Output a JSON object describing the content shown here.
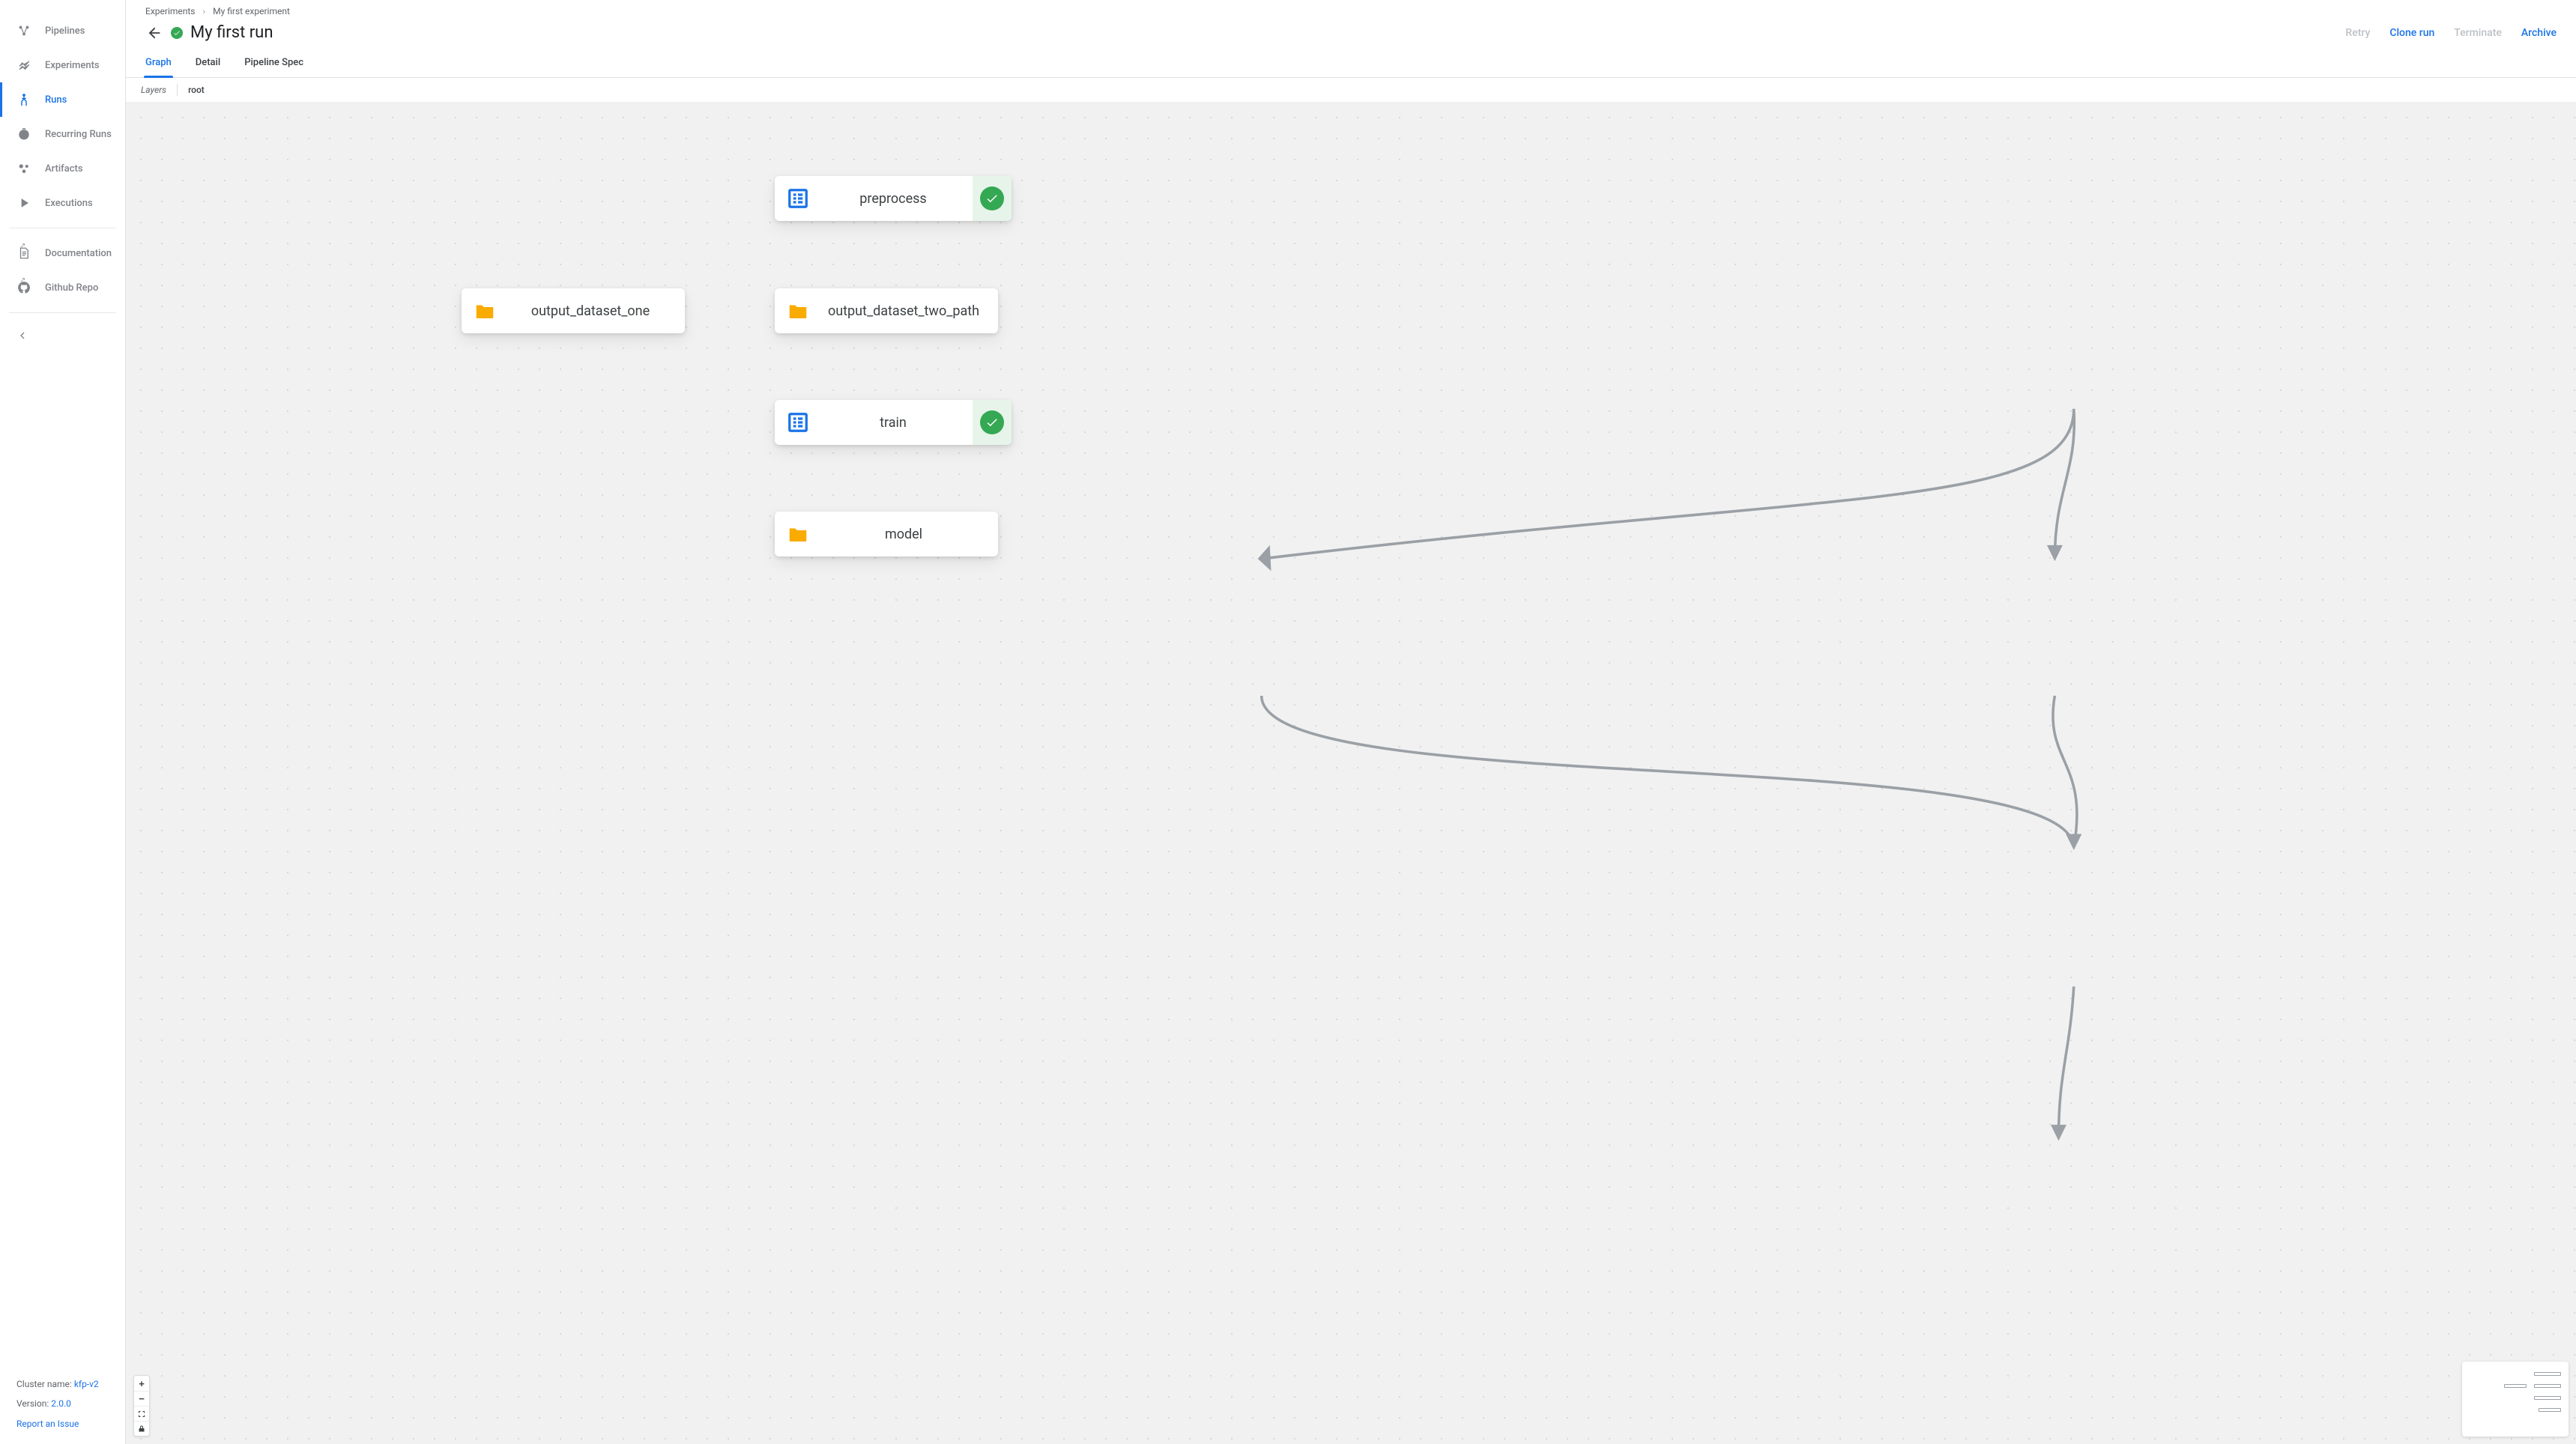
{
  "sidebar": {
    "items": [
      {
        "label": "Pipelines",
        "icon": "pipelines-icon",
        "active": false
      },
      {
        "label": "Experiments",
        "icon": "experiments-icon",
        "active": false
      },
      {
        "label": "Runs",
        "icon": "runs-icon",
        "active": true
      },
      {
        "label": "Recurring Runs",
        "icon": "recurring-runs-icon",
        "active": false
      },
      {
        "label": "Artifacts",
        "icon": "artifacts-icon",
        "active": false
      },
      {
        "label": "Executions",
        "icon": "executions-icon",
        "active": false
      }
    ],
    "external": [
      {
        "label": "Documentation",
        "icon": "documentation-icon"
      },
      {
        "label": "Github Repo",
        "icon": "github-icon"
      }
    ],
    "footer": {
      "cluster_label": "Cluster name:",
      "cluster_value": "kfp-v2",
      "version_label": "Version:",
      "version_value": "2.0.0",
      "report_label": "Report an Issue"
    }
  },
  "breadcrumbs": {
    "items": [
      "Experiments",
      "My first experiment"
    ]
  },
  "header": {
    "title": "My first run",
    "status": "success",
    "actions": {
      "retry": "Retry",
      "clone": "Clone run",
      "terminate": "Terminate",
      "archive": "Archive"
    }
  },
  "tabs": {
    "items": [
      "Graph",
      "Detail",
      "Pipeline Spec"
    ],
    "active": 0
  },
  "layers": {
    "label": "Layers",
    "root": "root"
  },
  "graph": {
    "nodes": {
      "preprocess": {
        "label": "preprocess",
        "type": "task",
        "status": "success"
      },
      "dataset_one": {
        "label": "output_dataset_one",
        "type": "artifact"
      },
      "dataset_two": {
        "label": "output_dataset_two_path",
        "type": "artifact"
      },
      "train": {
        "label": "train",
        "type": "task",
        "status": "success"
      },
      "model": {
        "label": "model",
        "type": "artifact"
      }
    },
    "edges": [
      {
        "from": "preprocess",
        "to": "dataset_one"
      },
      {
        "from": "preprocess",
        "to": "dataset_two"
      },
      {
        "from": "dataset_one",
        "to": "train"
      },
      {
        "from": "dataset_two",
        "to": "train"
      },
      {
        "from": "train",
        "to": "model"
      }
    ]
  },
  "zoom": {
    "in": "+",
    "out": "−"
  },
  "colors": {
    "primary": "#1a73e8",
    "success": "#34a853",
    "artifact": "#f9ab00"
  }
}
